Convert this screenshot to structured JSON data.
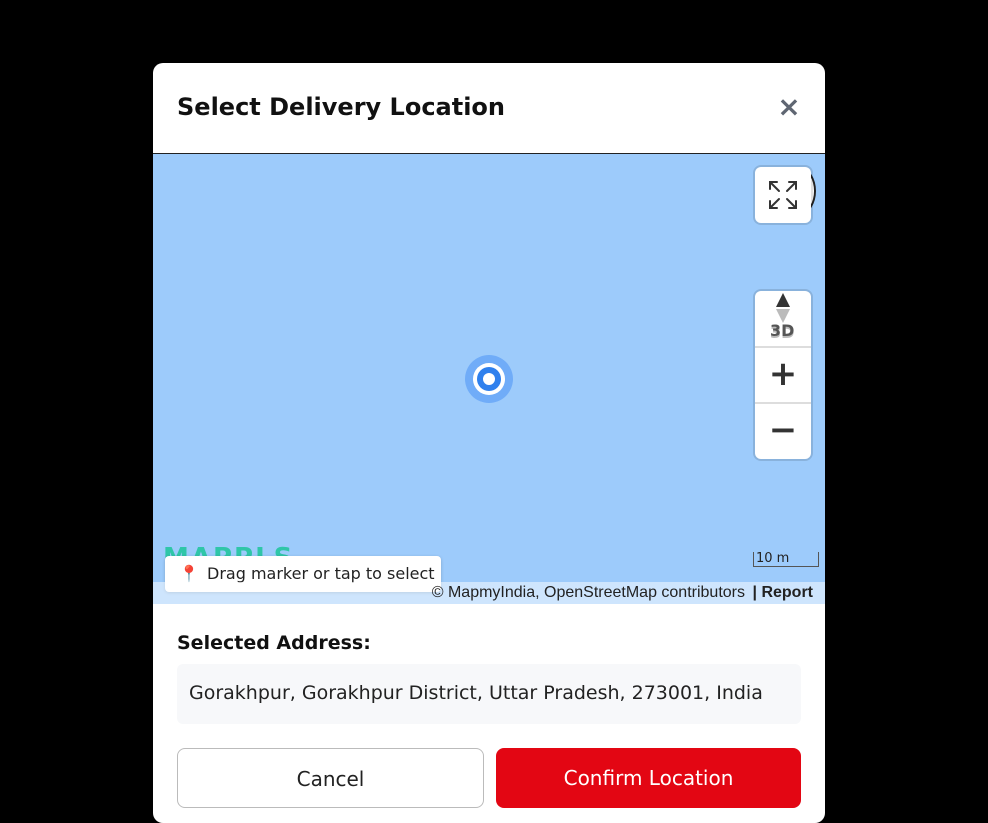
{
  "modal": {
    "title": "Select Delivery Location",
    "close_symbol": "×"
  },
  "map": {
    "fullscreen_icon": "expand-icon",
    "three_d_label": "3D",
    "zoom_in_label": "+",
    "zoom_out_label": "−",
    "logo_text": "MAPPLS",
    "scale_label": "10 m",
    "hint": {
      "icon": "📍",
      "text": "Drag marker or tap to select"
    },
    "attribution": "© MapmyIndia, OpenStreetMap contributors",
    "report_label": "| Report",
    "colors": {
      "water": "#9dcbfb",
      "marker": "#2f80ed"
    }
  },
  "address": {
    "label": "Selected Address:",
    "value": "Gorakhpur, Gorakhpur District, Uttar Pradesh, 273001, India"
  },
  "actions": {
    "cancel_label": "Cancel",
    "confirm_label": "Confirm Location",
    "confirm_color": "#e30613"
  }
}
